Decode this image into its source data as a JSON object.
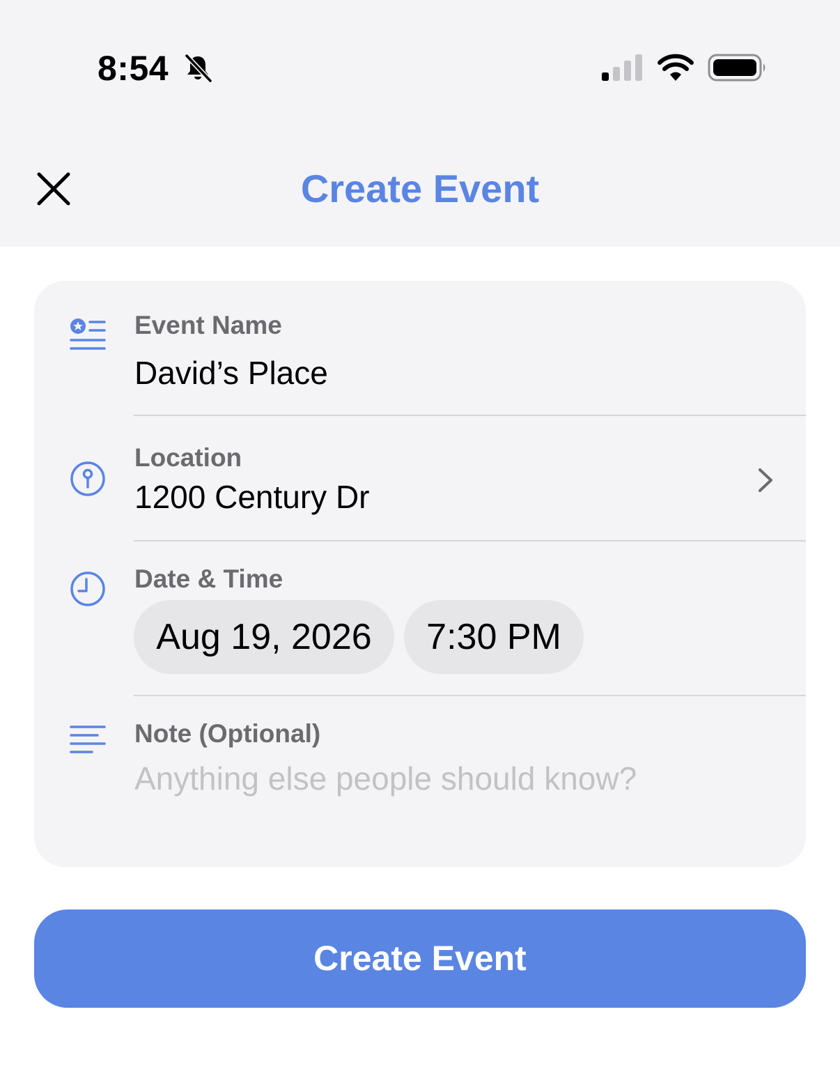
{
  "status_bar": {
    "time": "8:54",
    "icons": [
      "bell-slash-icon",
      "cellular-signal-icon",
      "wifi-icon",
      "battery-icon"
    ]
  },
  "nav": {
    "close_icon": "close-icon",
    "title": "Create Event"
  },
  "form": {
    "event_name": {
      "icon": "event-name-icon",
      "label": "Event Name",
      "value": "David’s Place"
    },
    "location": {
      "icon": "location-pin-icon",
      "label": "Location",
      "value": "1200 Century Dr",
      "accessory": "chevron-right-icon"
    },
    "date_time": {
      "icon": "clock-icon",
      "label": "Date & Time",
      "date": "Aug 19, 2026",
      "time": "7:30 PM"
    },
    "note": {
      "icon": "note-lines-icon",
      "label": "Note (Optional)",
      "placeholder": "Anything else people should know?"
    }
  },
  "primary_button": {
    "label": "Create Event"
  },
  "colors": {
    "accent": "#5a85e3",
    "background_grey": "#f4f4f7",
    "pill": "#e6e6e9",
    "label_grey": "#6b6b6f",
    "placeholder_grey": "#c2c2c6"
  }
}
